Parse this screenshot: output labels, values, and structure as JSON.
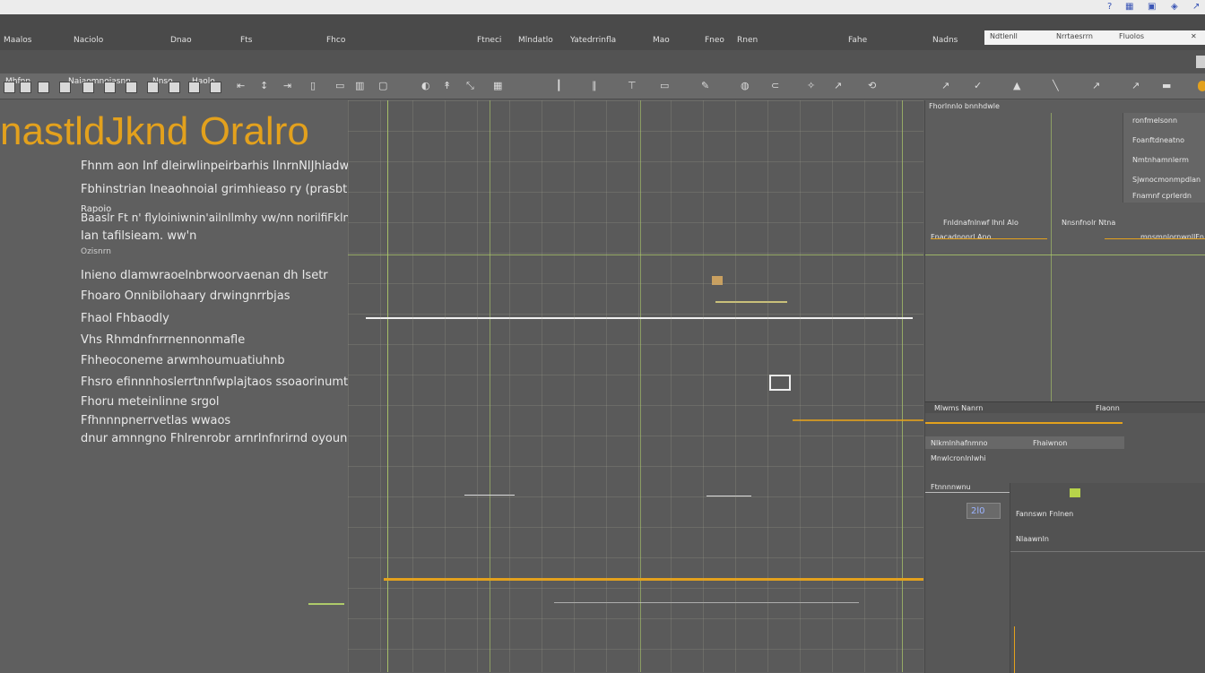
{
  "app": {
    "heading": "nastldJknd Oralro",
    "accent_color": "#e3a11d",
    "grid_line_color": "#aeca6a",
    "panel_color": "#5f5f5f"
  },
  "menubar": {
    "items": [
      "Maalos",
      "Naciolo",
      "Dnao",
      "Fts",
      "Fhco",
      "Ftneci",
      "Mlndatlo",
      "Yatedrrinfla",
      "Mao",
      "Fneo",
      "Rnen",
      "Fahe",
      "Nadns"
    ],
    "window_tab_1": "Ndtlenll",
    "window_tab_2": "Nrrtaesrrn",
    "window_tab_3": "Fluolos"
  },
  "toolbar": {
    "items": [
      "Mhfnn",
      "Naiaomnoiasnn",
      "Nnso",
      "Haolo"
    ]
  },
  "left_text": {
    "lines": [
      "Fhnm aon Inf dleirwlinpeirbarhis IlnrnNIJhladwdat daohndhaineanltmlomn uhmy sslitaiotrhniw VNlan ftiasb;IJ",
      "Fbhinstrian Ineaohnoial grimhieaso ry (prasbthe. marknu orutlechl (Uhlo ewanarnt In bidnofl ofl pipranac",
      "Rapoio",
      "Baaslr Ft n' flyloiniwnin'ailnllmhy vw/nn norilfiFklnnanflwl nwr Oli pnyoqat fl aaehnrts VNnsrrn mlUlalnand bnroliwfiasmoiwfl nanOiUl; Inrtaslog",
      "Ian tafilsieam. ww'n",
      "Ozisnrn",
      "Inieno dlamwraoelnbrwoorvaenan dh Isetr",
      "Fhoaro Onnibilohaary drwingnrrbjas",
      "Fhaol Fhbaodly",
      "Vhs Rhmdnfnrrnennonmafle",
      "Fhheoconeme arwmhoumuatiuhnb",
      "Fhsro efinnnhoslerrtnnfwplajtaos ssoaorinumtto",
      "Fhoru meteinlinne srgol",
      "Ffhnnnpnerrvetlas wwaos",
      "dnur amnngno Fhlrenrobr arnrlnfnrirnd oyounrufe"
    ]
  },
  "right_panel_top": {
    "header": "Fhorlnnlo bnnhdwle",
    "rows": [
      "ronfmelsonn",
      "Foanftdneatno",
      "Nmtnhamnlerm",
      "Sjwnocmonmpdlan",
      "Fnamnf cprlerdn"
    ],
    "label_a": "Fnldnafnlnwf Ihnl Alo",
    "label_b": "Fnacadnonrl Ano",
    "label_c": "Nnsnfnolr Ntna",
    "label_d": "mnsmnlornwnllFn"
  },
  "right_panel_bottom": {
    "tabs": [
      "Mlwms Nanrn",
      "Flaonn",
      "Fhaiwnon"
    ],
    "rows": [
      "Nlkmlnhafnmno",
      "Mnwlcronlnlwhi",
      "Ftnnnnwnu",
      "Nlaawnln"
    ],
    "value_label": "2l0",
    "sub_label": "Fannswn Fnlnen"
  }
}
